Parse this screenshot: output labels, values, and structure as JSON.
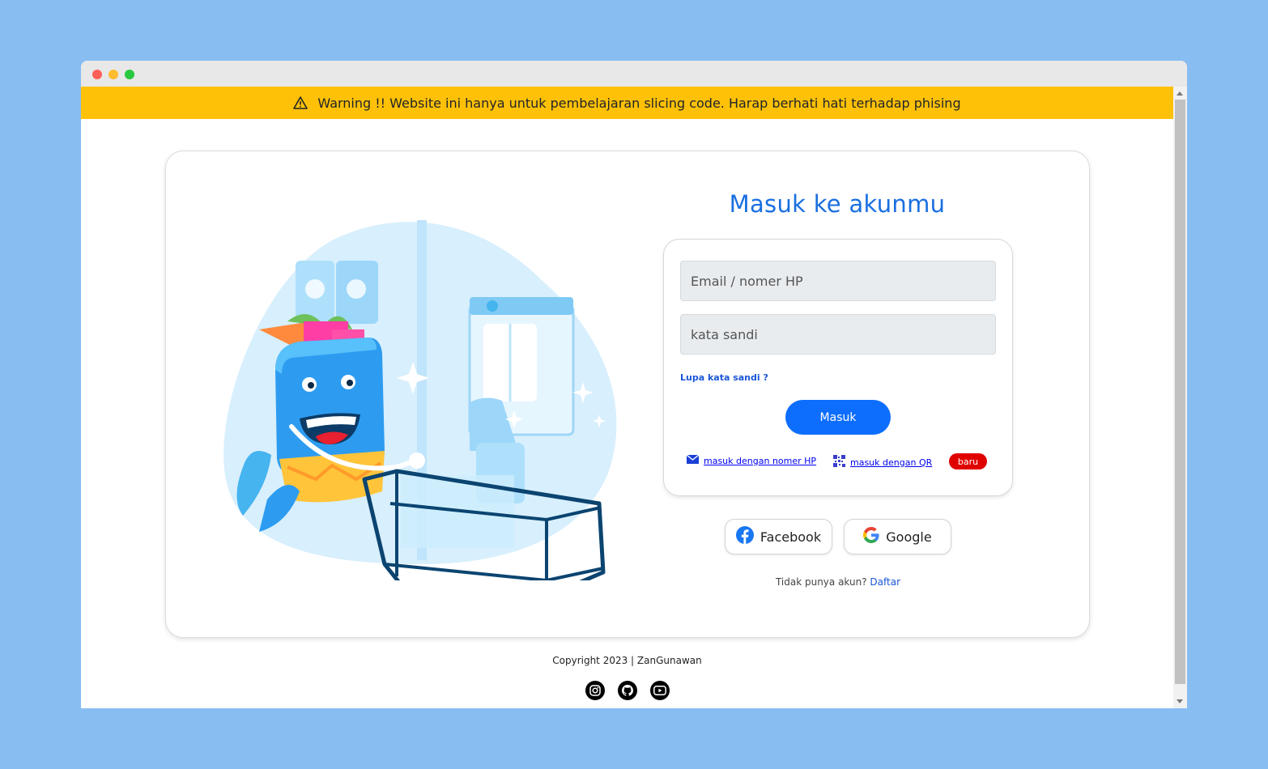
{
  "warning": {
    "text": "Warning !! Website ini hanya untuk pembelajaran slicing code. Harap berhati hati terhadap phising",
    "icon": "warning-triangle-icon"
  },
  "login": {
    "title": "Masuk ke akunmu",
    "email_placeholder": "Email / nomer HP",
    "password_placeholder": "kata sandi",
    "forgot_label": "Lupa kata sandi ?",
    "submit_label": "Masuk",
    "alt_phone_label": "masuk dengan nomer HP",
    "alt_qr_label": "masuk dengan QR",
    "badge_label": "baru"
  },
  "social": {
    "facebook_label": "Facebook",
    "google_label": "Google"
  },
  "signup": {
    "prompt": "Tidak punya akun?",
    "link_label": "Daftar"
  },
  "footer": {
    "copyright": "Copyright 2023 | ZanGunawan",
    "icons": [
      "instagram-icon",
      "github-icon",
      "youtube-icon"
    ]
  },
  "colors": {
    "page_background": "#88bdf2",
    "warning": "#ffc107",
    "primary": "#0d6efd",
    "title": "#1a6fe0",
    "badge": "#e00000"
  }
}
